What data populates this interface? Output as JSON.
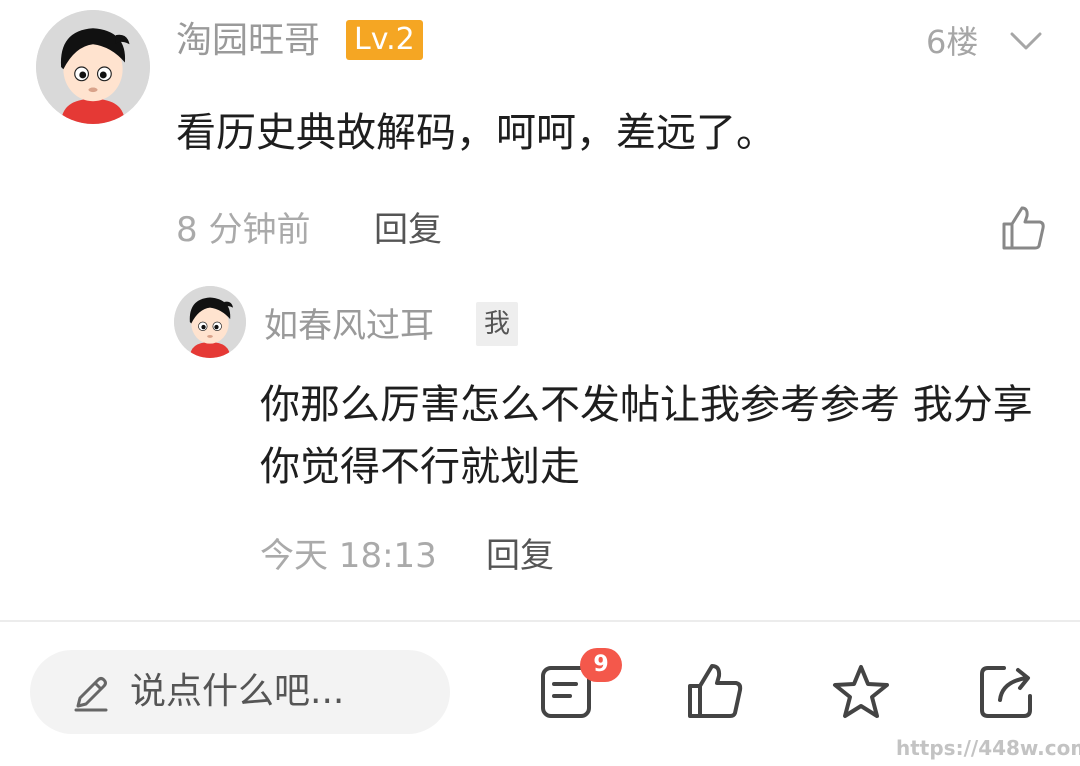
{
  "comment": {
    "username": "淘园旺哥",
    "level": "Lv.2",
    "floor": "6楼",
    "content": "看历史典故解码，呵呵，差远了。",
    "time": "8 分钟前",
    "reply_label": "回复",
    "avatar_icon": "cartoon-boy-avatar",
    "expand_icon": "chevron-down-icon",
    "like_icon": "thumbs-up-icon"
  },
  "reply": {
    "username": "如春风过耳",
    "me_badge": "我",
    "content": "你那么厉害怎么不发帖让我参考参考 我分享 你觉得不行就划走",
    "time": "今天 18:13",
    "reply_label": "回复",
    "avatar_icon": "cartoon-boy-avatar"
  },
  "bottom_bar": {
    "input_placeholder": "说点什么吧...",
    "comment_count": "9",
    "icons": [
      "pencil-icon",
      "comments-icon",
      "thumbs-up-icon",
      "star-icon",
      "share-icon"
    ]
  },
  "watermark": "https://448w.com",
  "colors": {
    "level_badge": "#f5a623",
    "count_badge": "#f4584b",
    "username": "#9a9a9a",
    "meta": "#aaaaaa"
  }
}
